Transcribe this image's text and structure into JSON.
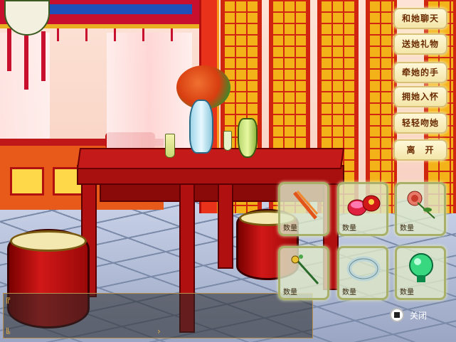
{
  "menu": {
    "items": [
      {
        "label": "和她聊天"
      },
      {
        "label": "送她礼物"
      },
      {
        "label": "牵她的手"
      },
      {
        "label": "拥她入怀"
      },
      {
        "label": "轻轻吻她"
      },
      {
        "label": "离　开"
      }
    ]
  },
  "gifts": {
    "qty_label": "数量",
    "items": [
      {
        "icon": "chopsticks-icon"
      },
      {
        "icon": "rouge-box-icon"
      },
      {
        "icon": "rose-icon"
      },
      {
        "icon": "hairpin-icon"
      },
      {
        "icon": "jade-bracelet-icon"
      },
      {
        "icon": "jade-pendant-icon"
      }
    ]
  },
  "close": {
    "label": "关闭"
  },
  "colors": {
    "accent": "#c41a1a",
    "menu_text": "#6a2a00",
    "screen_gold": "#f4b219"
  }
}
